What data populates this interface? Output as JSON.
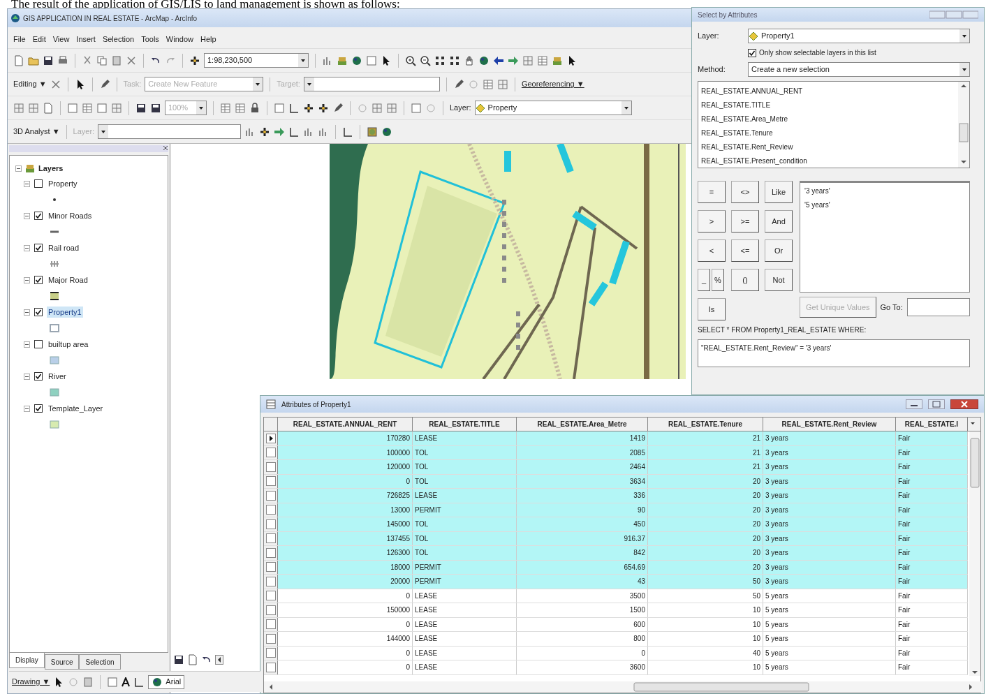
{
  "document_text": "The result of the application of GIS/LIS to land management is shown as follows:",
  "window": {
    "title": "GIS APPLICATION IN REAL ESTATE - ArcMap - ArcInfo"
  },
  "menu": [
    "File",
    "Edit",
    "View",
    "Insert",
    "Selection",
    "Tools",
    "Window",
    "Help"
  ],
  "toolbars": {
    "scale": "1:98,230,500",
    "editor": "Editing ▼",
    "task_label": "Task:",
    "task": "Create New Feature",
    "target_label": "Target:",
    "georeferencing": "Georeferencing ▼",
    "zoom": "100%",
    "layer_label": "Layer:",
    "layer": "Property",
    "analyst": "3D Analyst ▼",
    "analyst_layer_label": "Layer:"
  },
  "toc": {
    "root": "Layers",
    "layers": [
      {
        "name": "Property",
        "checked": false,
        "selected": false,
        "kind": "point",
        "color": "#333333"
      },
      {
        "name": "Minor Roads",
        "checked": true,
        "selected": false,
        "kind": "line",
        "color": "#666666"
      },
      {
        "name": "Rail road",
        "checked": true,
        "selected": false,
        "kind": "rail",
        "color": "#999999"
      },
      {
        "name": "Major Road",
        "checked": true,
        "selected": false,
        "kind": "road",
        "color": "#c8cf88"
      },
      {
        "name": "Property1",
        "checked": true,
        "selected": true,
        "kind": "outline",
        "color": "#9aa6b2"
      },
      {
        "name": "builtup area",
        "checked": false,
        "selected": false,
        "kind": "fill",
        "color": "#b9cfe8"
      },
      {
        "name": "River",
        "checked": true,
        "selected": false,
        "kind": "fill",
        "color": "#8fd1c0"
      },
      {
        "name": "Template_Layer",
        "checked": true,
        "selected": false,
        "kind": "fill",
        "color": "#d7ebb0"
      }
    ],
    "tabs": [
      {
        "label": "Display",
        "selected": true
      },
      {
        "label": "Source",
        "selected": false
      },
      {
        "label": "Selection",
        "selected": false
      }
    ]
  },
  "drawing_toolbar": {
    "menu": "Drawing ▼",
    "font": "Arial"
  },
  "select_dialog": {
    "title": "Select by Attributes",
    "layer_label": "Layer:",
    "layer": "Property1",
    "only_selectable": {
      "label": "Only show selectable layers in this list",
      "checked": true
    },
    "method_label": "Method:",
    "method": "Create a new selection",
    "fields": [
      "REAL_ESTATE.ANNUAL_RENT",
      "REAL_ESTATE.TITLE",
      "REAL_ESTATE.Area_Metre",
      "REAL_ESTATE.Tenure",
      "REAL_ESTATE.Rent_Review",
      "REAL_ESTATE.Present_condition"
    ],
    "operators": [
      "=",
      "<>",
      "Like",
      ">",
      ">=",
      "And",
      "<",
      "<=",
      "Or",
      "_",
      "%",
      "()",
      "Not",
      "Is"
    ],
    "values": [
      "'3 years'",
      "'5 years'"
    ],
    "unique_button": {
      "label": "Get Unique Values",
      "disabled": true
    },
    "goto_label": "Go To:",
    "sql_prefix": "SELECT * FROM Property1_REAL_ESTATE WHERE:",
    "expression": "\"REAL_ESTATE.Rent_Review\" = '3 years'"
  },
  "attribute_table": {
    "title": "Attributes of Property1",
    "columns": [
      "REAL_ESTATE.ANNUAL_RENT",
      "REAL_ESTATE.TITLE",
      "REAL_ESTATE.Area_Metre",
      "REAL_ESTATE.Tenure",
      "REAL_ESTATE.Rent_Review",
      "REAL_ESTATE.I"
    ],
    "rows": [
      {
        "cells": [
          "170280",
          "LEASE",
          "1419",
          "21",
          "3 years",
          "Fair"
        ],
        "selected": true,
        "current": true
      },
      {
        "cells": [
          "100000",
          "TOL",
          "2085",
          "21",
          "3 years",
          "Fair"
        ],
        "selected": true,
        "current": false
      },
      {
        "cells": [
          "120000",
          "TOL",
          "2464",
          "21",
          "3 years",
          "Fair"
        ],
        "selected": true,
        "current": false
      },
      {
        "cells": [
          "0",
          "TOL",
          "3634",
          "20",
          "3 years",
          "Fair"
        ],
        "selected": true,
        "current": false
      },
      {
        "cells": [
          "726825",
          "LEASE",
          "336",
          "20",
          "3 years",
          "Fair"
        ],
        "selected": true,
        "current": false
      },
      {
        "cells": [
          "13000",
          "PERMIT",
          "90",
          "20",
          "3 years",
          "Fair"
        ],
        "selected": true,
        "current": false
      },
      {
        "cells": [
          "145000",
          "TOL",
          "450",
          "20",
          "3 years",
          "Fair"
        ],
        "selected": true,
        "current": false
      },
      {
        "cells": [
          "137455",
          "TOL",
          "916.37",
          "20",
          "3 years",
          "Fair"
        ],
        "selected": true,
        "current": false
      },
      {
        "cells": [
          "126300",
          "TOL",
          "842",
          "20",
          "3 years",
          "Fair"
        ],
        "selected": true,
        "current": false
      },
      {
        "cells": [
          "18000",
          "PERMIT",
          "654.69",
          "20",
          "3 years",
          "Fair"
        ],
        "selected": true,
        "current": false
      },
      {
        "cells": [
          "20000",
          "PERMIT",
          "43",
          "50",
          "3 years",
          "Fair"
        ],
        "selected": true,
        "current": false
      },
      {
        "cells": [
          "0",
          "LEASE",
          "3500",
          "50",
          "5 years",
          "Fair"
        ],
        "selected": false,
        "current": false
      },
      {
        "cells": [
          "150000",
          "LEASE",
          "1500",
          "10",
          "5 years",
          "Fair"
        ],
        "selected": false,
        "current": false
      },
      {
        "cells": [
          "0",
          "LEASE",
          "600",
          "10",
          "5 years",
          "Fair"
        ],
        "selected": false,
        "current": false
      },
      {
        "cells": [
          "144000",
          "LEASE",
          "800",
          "10",
          "5 years",
          "Fair"
        ],
        "selected": false,
        "current": false
      },
      {
        "cells": [
          "0",
          "LEASE",
          "0",
          "40",
          "5 years",
          "Fair"
        ],
        "selected": false,
        "current": false
      },
      {
        "cells": [
          "0",
          "LEASE",
          "3600",
          "10",
          "5 years",
          "Fair"
        ],
        "selected": false,
        "current": false
      }
    ]
  }
}
